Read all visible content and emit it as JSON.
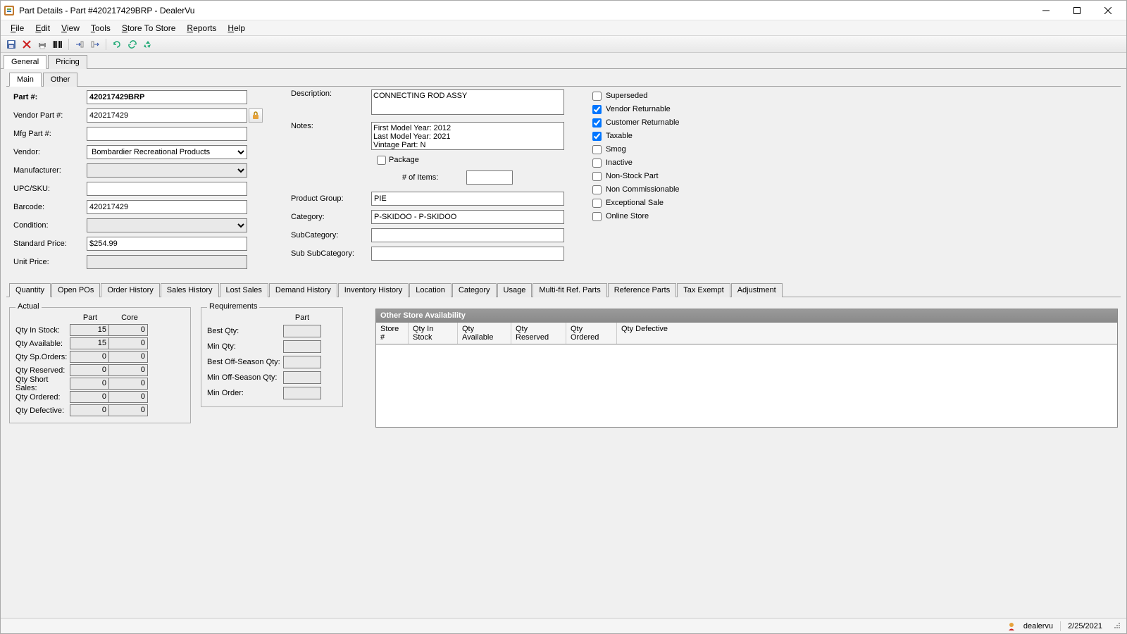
{
  "window": {
    "title": "Part Details - Part #420217429BRP - DealerVu"
  },
  "menubar": [
    "File",
    "Edit",
    "View",
    "Tools",
    "Store To Store",
    "Reports",
    "Help"
  ],
  "outer_tabs": [
    "General",
    "Pricing"
  ],
  "inner_tabs": [
    "Main",
    "Other"
  ],
  "labels": {
    "part_no": "Part #:",
    "vendor_part": "Vendor Part #:",
    "mfg_part": "Mfg Part #:",
    "vendor": "Vendor:",
    "manufacturer": "Manufacturer:",
    "upc": "UPC/SKU:",
    "barcode": "Barcode:",
    "condition": "Condition:",
    "std_price": "Standard Price:",
    "unit_price": "Unit Price:",
    "description": "Description:",
    "notes": "Notes:",
    "product_group": "Product Group:",
    "category": "Category:",
    "subcategory": "SubCategory:",
    "subsubcategory": "Sub SubCategory:",
    "package": "Package",
    "num_items": "# of Items:"
  },
  "fields": {
    "part_no": "420217429BRP",
    "vendor_part": "420217429",
    "mfg_part": "",
    "vendor": "Bombardier Recreational Products",
    "manufacturer": "",
    "upc": "",
    "barcode": "420217429",
    "condition": "",
    "std_price": "$254.99",
    "unit_price": "",
    "description": "CONNECTING ROD ASSY",
    "notes": "First Model Year: 2012\nLast Model Year: 2021\nVintage Part: N",
    "product_group": "PIE",
    "category": "P-SKIDOO - P-SKIDOO",
    "subcategory": "",
    "subsubcategory": "",
    "num_items": ""
  },
  "checks": {
    "superseded": {
      "label": "Superseded",
      "checked": false
    },
    "vendor_ret": {
      "label": "Vendor Returnable",
      "checked": true
    },
    "customer_ret": {
      "label": "Customer Returnable",
      "checked": true
    },
    "taxable": {
      "label": "Taxable",
      "checked": true
    },
    "smog": {
      "label": "Smog",
      "checked": false
    },
    "inactive": {
      "label": "Inactive",
      "checked": false
    },
    "nonstock": {
      "label": "Non-Stock Part",
      "checked": false
    },
    "noncomm": {
      "label": "Non Commissionable",
      "checked": false
    },
    "exceptional": {
      "label": "Exceptional Sale",
      "checked": false
    },
    "online": {
      "label": "Online Store",
      "checked": false
    },
    "package": {
      "checked": false
    }
  },
  "sub_tabs": [
    "Quantity",
    "Open POs",
    "Order History",
    "Sales History",
    "Lost Sales",
    "Demand History",
    "Inventory History",
    "Location",
    "Category",
    "Usage",
    "Multi-fit Ref. Parts",
    "Reference Parts",
    "Tax Exempt",
    "Adjustment"
  ],
  "actual": {
    "legend": "Actual",
    "heads": [
      "Part",
      "Core"
    ],
    "rows": [
      {
        "l": "Qty In Stock:",
        "p": "15",
        "c": "0"
      },
      {
        "l": "Qty Available:",
        "p": "15",
        "c": "0"
      },
      {
        "l": "Qty Sp.Orders:",
        "p": "0",
        "c": "0"
      },
      {
        "l": "Qty Reserved:",
        "p": "0",
        "c": "0"
      },
      {
        "l": "Qty Short Sales:",
        "p": "0",
        "c": "0"
      },
      {
        "l": "Qty Ordered:",
        "p": "0",
        "c": "0"
      },
      {
        "l": "Qty Defective:",
        "p": "0",
        "c": "0"
      }
    ]
  },
  "requirements": {
    "legend": "Requirements",
    "head": "Part",
    "rows": [
      {
        "l": "Best Qty:"
      },
      {
        "l": "Min Qty:"
      },
      {
        "l": "Best Off-Season Qty:"
      },
      {
        "l": "Min Off-Season Qty:"
      },
      {
        "l": "Min Order:"
      }
    ]
  },
  "availability": {
    "title": "Other Store Availability",
    "cols": [
      "Store #",
      "Qty In Stock",
      "Qty Available",
      "Qty Reserved",
      "Qty Ordered",
      "Qty Defective"
    ]
  },
  "status": {
    "user": "dealervu",
    "date": "2/25/2021"
  }
}
